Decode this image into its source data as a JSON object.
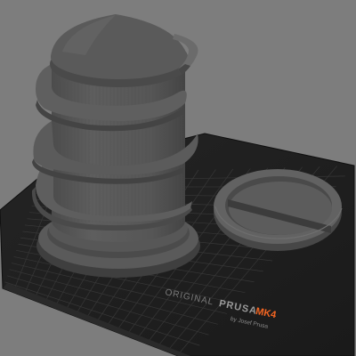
{
  "bed": {
    "brand_original": "ORIGINAL",
    "brand_prusa": "PRUSA",
    "brand_model": "MK4",
    "brand_byline": "by Josef Prusa",
    "accent_color": "#f26522",
    "surface_color": "#1c1c1c"
  },
  "scene": {
    "background_color": "#7d7d7d",
    "model_color": "#555555",
    "objects": [
      "tall-threaded-container",
      "round-lid"
    ]
  }
}
